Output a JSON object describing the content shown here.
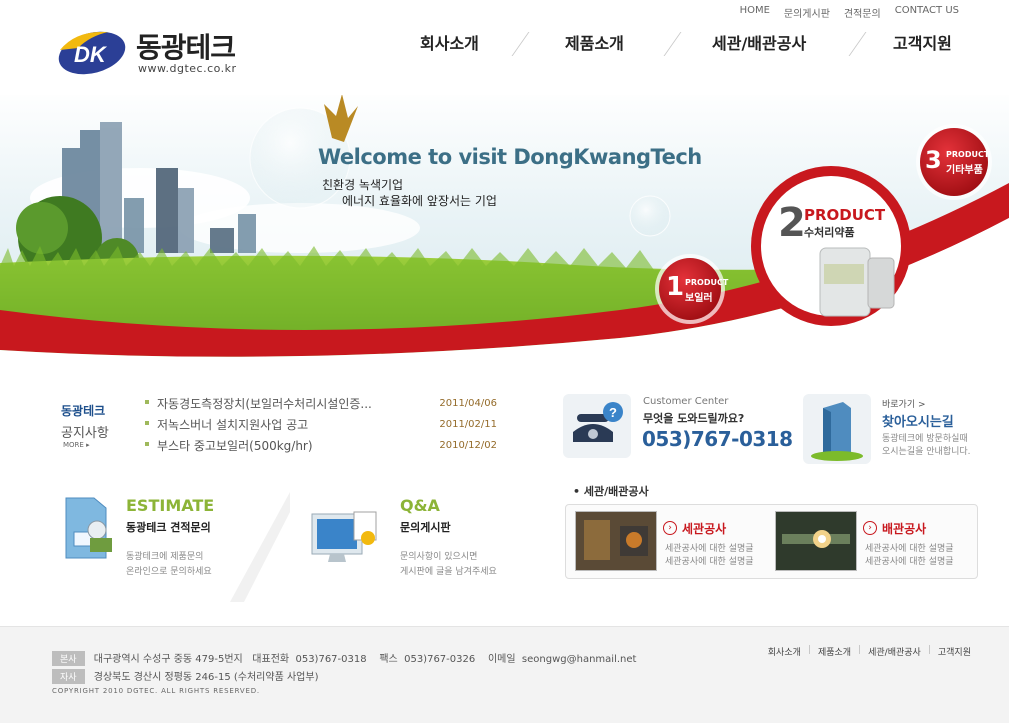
{
  "header": {
    "brand": "동광테크",
    "url": "www.dgtec.co.kr",
    "logo_letters": "DK",
    "util_nav": [
      "HOME",
      "문의게시판",
      "견적문의",
      "CONTACT US"
    ],
    "gnb": [
      "회사소개",
      "제품소개",
      "세관/배관공사",
      "고객지원"
    ]
  },
  "visual": {
    "welcome": "Welcome to visit DongKwangTech",
    "slogan1": "친환경 녹색기업",
    "slogan2": "에너지 효율화에 앞장서는 기업",
    "products": [
      {
        "num": "1",
        "tag": "PRODUCT",
        "name": "보일러"
      },
      {
        "num": "2",
        "tag": "PRODUCT",
        "name": "수처리약품"
      },
      {
        "num": "3",
        "tag": "PRODUCT",
        "name": "기타부품"
      }
    ]
  },
  "notice": {
    "title1": "동광테크",
    "title2": "공지사항",
    "more": "MORE",
    "items": [
      {
        "title": "자동경도측정장치(보일러수처리시설인증...",
        "date": "2011/04/06"
      },
      {
        "title": "저녹스버너 설치지원사업 공고",
        "date": "2011/02/11"
      },
      {
        "title": "부스타 중고보일러(500kg/hr)",
        "date": "2010/12/02"
      }
    ]
  },
  "estimate": {
    "eng": "ESTIMATE",
    "kor": "동광테크 견적문의",
    "d1": "동광테크에 제품문의",
    "d2": "온라인으로 문의하세요"
  },
  "qna": {
    "eng": "Q&A",
    "kor": "문의게시판",
    "d1": "문의사항이 있으시면",
    "d2": "게시판에 글을 남겨주세요"
  },
  "customer_center": {
    "label": "Customer Center",
    "question": "무엇을 도와드릴까요?",
    "phone": "053)767-0318"
  },
  "location": {
    "goto": "바로가기 >",
    "title": "찾아오시는길",
    "d1": "동광테크에 방문하실때",
    "d2": "오시는길을 안내합니다."
  },
  "construction": {
    "title": "세관/배관공사",
    "cards": [
      {
        "title": "세관공사",
        "d1": "세관공사에 대한 설명글",
        "d2": "세관공사에 대한 설명글"
      },
      {
        "title": "배관공사",
        "d1": "세관공사에 대한 설명글",
        "d2": "세관공사에 대한 설명글"
      }
    ]
  },
  "footer": {
    "badge_main": "본사",
    "main_address": "대구광역시 수성구 중동 479-5번지",
    "tel_label": "대표전화",
    "tel": "053)767-0318",
    "fax_label": "팩스",
    "fax": "053)767-0326",
    "email_label": "이메일",
    "email": "seongwg@hanmail.net",
    "badge_branch": "자사",
    "branch_address": "경상북도 경산시 정평동 246-15 (수처리약품 사업부)",
    "copyright": "COPYRIGHT 2010 DGTEC. ALL RIGHTS RESERVED.",
    "nav": [
      "회사소개",
      "제품소개",
      "세관/배관공사",
      "고객지원"
    ]
  },
  "colors": {
    "brand_blue": "#2a5f9a",
    "accent_red": "#c8181e",
    "accent_green": "#8cb437",
    "logo_yellow": "#f2b90f"
  }
}
